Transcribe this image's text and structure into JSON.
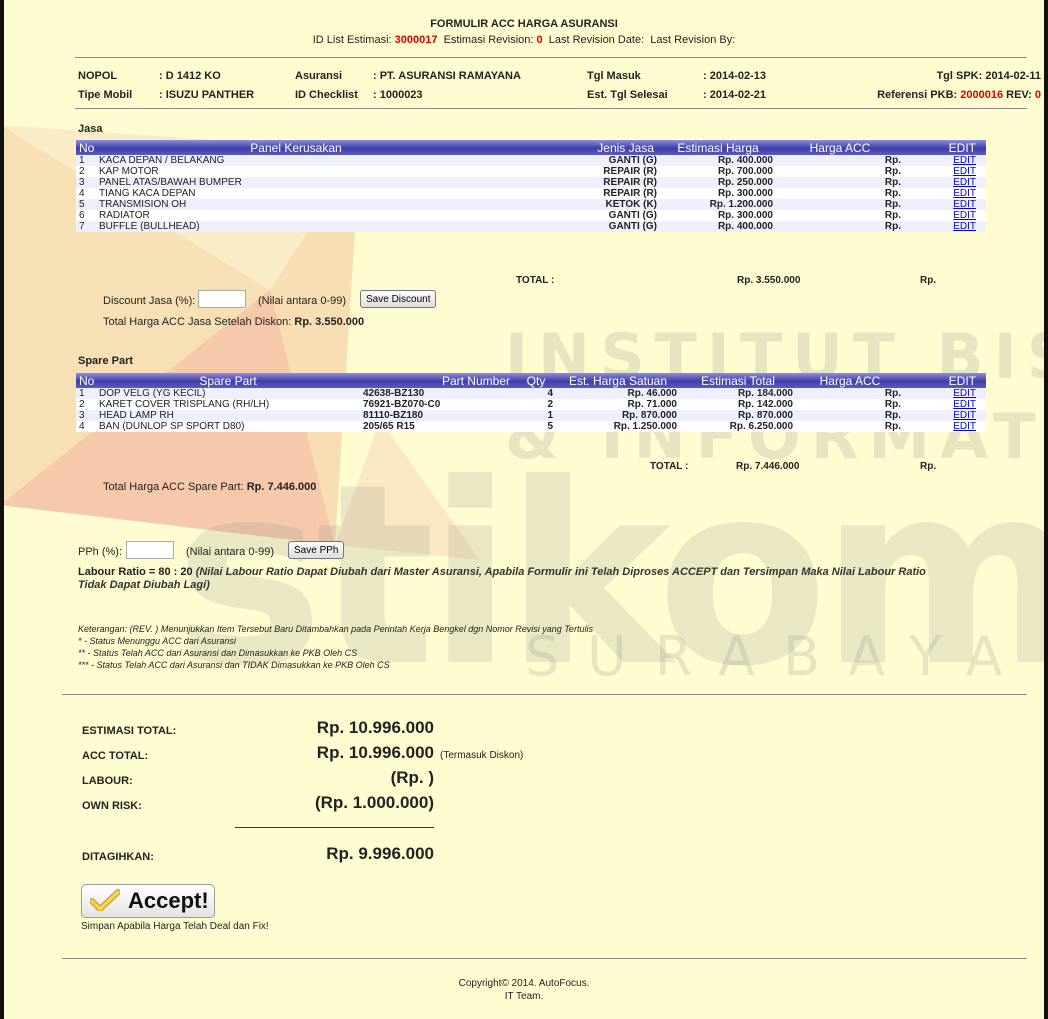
{
  "header": {
    "title": "FORMULIR ACC HARGA ASURANSI",
    "id_list_label": "ID List Estimasi:",
    "id_list_value": "3000017",
    "est_rev_label": "Estimasi Revision:",
    "est_rev_value": "0",
    "last_rev_date_label": "Last Revision Date:",
    "last_rev_by_label": "Last Revision By:"
  },
  "info": {
    "nopol_label": "NOPOL",
    "nopol_value": ": D 1412 KO",
    "tipe_label": "Tipe Mobil",
    "tipe_value": ": ISUZU PANTHER",
    "asuransi_label": "Asuransi",
    "asuransi_value": ": PT. ASURANSI RAMAYANA",
    "idcheck_label": "ID Checklist",
    "idcheck_value": ": 1000023",
    "tglmasuk_label": "Tgl Masuk",
    "tglmasuk_value": ": 2014-02-13",
    "esttgl_label": "Est. Tgl Selesai",
    "esttgl_value": ": 2014-02-21",
    "tglspk": "Tgl SPK: 2014-02-11",
    "refpkb_label": "Referensi PKB:",
    "refpkb_value": "2000016",
    "rev_label": "REV:",
    "rev_value": "0"
  },
  "jasa": {
    "title": "Jasa",
    "headers": [
      "No",
      "Panel Kerusakan",
      "Jenis Jasa",
      "Estimasi Harga",
      "Harga ACC",
      "EDIT"
    ],
    "rows": [
      {
        "no": "1",
        "panel": "KACA DEPAN / BELAKANG",
        "jenis": "GANTI (G)",
        "est": "Rp. 400.000",
        "acc": "Rp.",
        "edit": "EDIT"
      },
      {
        "no": "2",
        "panel": "KAP MOTOR",
        "jenis": "REPAIR (R)",
        "est": "Rp. 700.000",
        "acc": "Rp.",
        "edit": "EDIT"
      },
      {
        "no": "3",
        "panel": "PANEL ATAS/BAWAH BUMPER",
        "jenis": "REPAIR (R)",
        "est": "Rp. 250.000",
        "acc": "Rp.",
        "edit": "EDIT"
      },
      {
        "no": "4",
        "panel": "TIANG KACA DEPAN",
        "jenis": "REPAIR (R)",
        "est": "Rp. 300.000",
        "acc": "Rp.",
        "edit": "EDIT"
      },
      {
        "no": "5",
        "panel": "TRANSMISION OH",
        "jenis": "KETOK (K)",
        "est": "Rp. 1.200.000",
        "acc": "Rp.",
        "edit": "EDIT"
      },
      {
        "no": "6",
        "panel": "RADIATOR",
        "jenis": "GANTI (G)",
        "est": "Rp. 300.000",
        "acc": "Rp.",
        "edit": "EDIT"
      },
      {
        "no": "7",
        "panel": "BUFFLE (BULLHEAD)",
        "jenis": "GANTI (G)",
        "est": "Rp. 400.000",
        "acc": "Rp.",
        "edit": "EDIT"
      }
    ],
    "total_label": "TOTAL :",
    "total_est": "Rp. 3.550.000",
    "total_acc": "Rp.",
    "discount_label": "Discount Jasa (%):",
    "discount_value": "",
    "discount_hint": "(Nilai antara 0-99)",
    "save_discount": "Save Discount",
    "total_after_label": "Total Harga ACC Jasa Setelah Diskon:",
    "total_after_value": "Rp. 3.550.000"
  },
  "spare": {
    "title": "Spare Part",
    "headers": [
      "No",
      "Spare Part",
      "Part Number",
      "Qty",
      "Est. Harga Satuan",
      "Estimasi Total",
      "Harga ACC",
      "EDIT"
    ],
    "rows": [
      {
        "no": "1",
        "part": "DOP VELG (YG KECIL)",
        "pn": "42638-BZ130",
        "qty": "4",
        "sat": "Rp. 46.000",
        "tot": "Rp. 184.000",
        "acc": "Rp.",
        "edit": "EDIT"
      },
      {
        "no": "2",
        "part": "KARET COVER TRISPLANG (RH/LH)",
        "pn": "76921-BZ070-C0",
        "qty": "2",
        "sat": "Rp. 71.000",
        "tot": "Rp. 142.000",
        "acc": "Rp.",
        "edit": "EDIT"
      },
      {
        "no": "3",
        "part": "HEAD LAMP RH",
        "pn": "81110-BZ180",
        "qty": "1",
        "sat": "Rp. 870.000",
        "tot": "Rp. 870.000",
        "acc": "Rp.",
        "edit": "EDIT"
      },
      {
        "no": "4",
        "part": "BAN (DUNLOP SP SPORT D80)",
        "pn": "205/65 R15",
        "qty": "5",
        "sat": "Rp. 1.250.000",
        "tot": "Rp. 6.250.000",
        "acc": "Rp.",
        "edit": "EDIT"
      }
    ],
    "total_label": "TOTAL :",
    "total_est": "Rp. 7.446.000",
    "total_acc": "Rp.",
    "total_acc_label": "Total Harga ACC Spare Part:",
    "total_acc_value": "Rp. 7.446.000"
  },
  "pph": {
    "label": "PPh (%):",
    "value": "",
    "hint": "(Nilai antara 0-99)",
    "save": "Save PPh"
  },
  "labour": {
    "label": "Labour Ratio = 80 : 20",
    "note_line1": "(Nilai Labour Ratio Dapat Diubah dari Master Asuransi, Apabila Formulir ini Telah Diproses ACCEPT dan Tersimpan Maka Nilai Labour Ratio",
    "note_line2": "Tidak Dapat Diubah Lagi)"
  },
  "keterangan": {
    "line1": "Keterangan: (REV. ) Menunjukkan Item Tersebut Baru Ditambahkan pada Perintah Kerja Bengkel dgn Nomor Revisi yang Tertulis",
    "line2": "* - Status Menunggu ACC dari Asuransi",
    "line3": "** - Status Telah ACC dari Asuransi dan Dimasukkan ke PKB Oleh CS",
    "line4": "*** - Status Telah ACC dari Asuransi dan TIDAK Dimasukkan ke PKB Oleh CS"
  },
  "summary": {
    "estimasi_label": "ESTIMASI TOTAL:",
    "estimasi_value": "Rp. 10.996.000",
    "acc_label": "ACC TOTAL:",
    "acc_value": "Rp. 10.996.000",
    "acc_note": "(Termasuk Diskon)",
    "labour_label": "LABOUR:",
    "labour_value": "(Rp. )",
    "ownrisk_label": "OWN RISK:",
    "ownrisk_value": "(Rp. 1.000.000)",
    "ditagihkan_label": "DITAGIHKAN:",
    "ditagihkan_value": "Rp. 9.996.000"
  },
  "accept": {
    "label": "Accept!",
    "note": "Simpan Apabila Harga Telah Deal dan Fix!",
    "icon": "check-icon"
  },
  "footer": {
    "copyright": "Copyright© 2014. AutoFocus.",
    "team": "IT Team."
  },
  "watermark": {
    "line1": "INSTITUT BISNIS",
    "line2": "& INFORMATIKA",
    "line3": "stikom",
    "line4": "SURABAYA"
  },
  "colors": {
    "background": "#fffdd0",
    "header_bar": "#3f3fa8",
    "highlight_red": "#e00000",
    "link": "#0000ee"
  }
}
